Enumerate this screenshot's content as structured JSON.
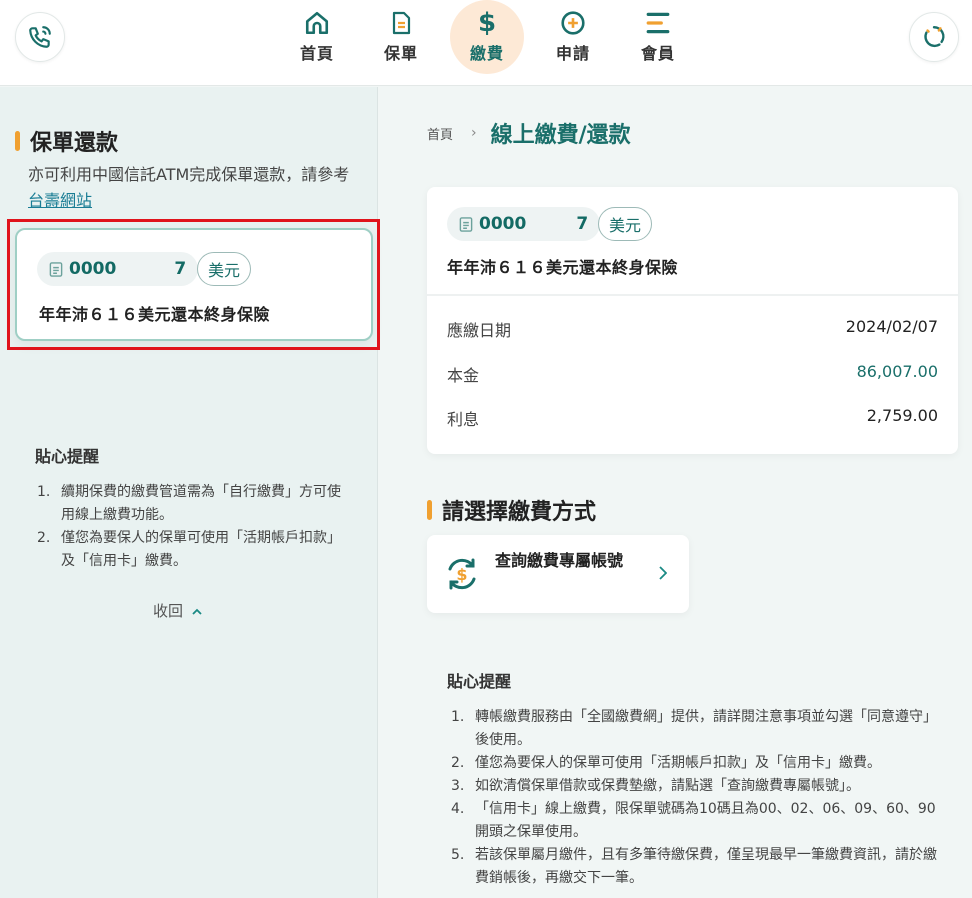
{
  "nav": {
    "items": [
      {
        "label": "首頁",
        "icon": "home-icon"
      },
      {
        "label": "保單",
        "icon": "document-icon"
      },
      {
        "label": "繳費",
        "icon": "dollar-icon"
      },
      {
        "label": "申請",
        "icon": "plus-circle-icon"
      },
      {
        "label": "會員",
        "icon": "menu-icon"
      }
    ],
    "active": "繳費",
    "left_button_icon": "phone-icon",
    "right_button_icon": "chat-icon"
  },
  "left": {
    "title": "保單還款",
    "desc_prefix": "亦可利用中國信託ATM完成保單還款，請參考 ",
    "desc_link": "台壽網站",
    "policy": {
      "number_head": "0000",
      "number_tail": "7",
      "currency": "美元",
      "name": "年年沛６１６美元還本終身保險"
    },
    "tips": {
      "title": "貼心提醒",
      "items": [
        {
          "num": "1.",
          "text": "續期保費的繳費管道需為「自行繳費」方可使用線上繳費功能。"
        },
        {
          "num": "2.",
          "text": "僅您為要保人的保單可使用「活期帳戶扣款」及「信用卡」繳費。"
        }
      ]
    },
    "collapse_label": "收回"
  },
  "breadcrumb": {
    "home": "首頁",
    "current": "線上繳費/還款"
  },
  "detail": {
    "policy": {
      "number_head": "0000",
      "number_tail": "7",
      "currency": "美元",
      "name": "年年沛６１６美元還本終身保險"
    },
    "rows": [
      {
        "label": "應繳日期",
        "value": "2024/02/07"
      },
      {
        "label": "本金",
        "value": "86,007.00"
      },
      {
        "label": "利息",
        "value": "2,759.00"
      }
    ]
  },
  "payment": {
    "title": "請選擇繳費方式",
    "method_label": "查詢繳費專屬帳號",
    "method_icon": "dollar-cycle-icon"
  },
  "right_tips": {
    "title": "貼心提醒",
    "items": [
      {
        "num": "1.",
        "text": "轉帳繳費服務由「全國繳費網」提供，請詳閱注意事項並勾選「同意遵守」後使用。"
      },
      {
        "num": "2.",
        "text": "僅您為要保人的保單可使用「活期帳戶扣款」及「信用卡」繳費。"
      },
      {
        "num": "3.",
        "text": "如欲清償保單借款或保費墊繳，請點選「查詢繳費專屬帳號」。"
      },
      {
        "num": "4.",
        "text": "「信用卡」線上繳費，限保單號碼為10碼且為00、02、06、09、60、90開頭之保單使用。"
      },
      {
        "num": "5.",
        "text": "若該保單屬月繳件，且有多筆待繳保費，僅呈現最早一筆繳費資訊，請於繳費銷帳後，再繳交下一筆。"
      }
    ]
  },
  "colors": {
    "accent_teal": "#1a6f6a",
    "accent_orange": "#f0a030",
    "highlight_red": "#e0141c",
    "active_nav_bg": "#fde9d6"
  }
}
